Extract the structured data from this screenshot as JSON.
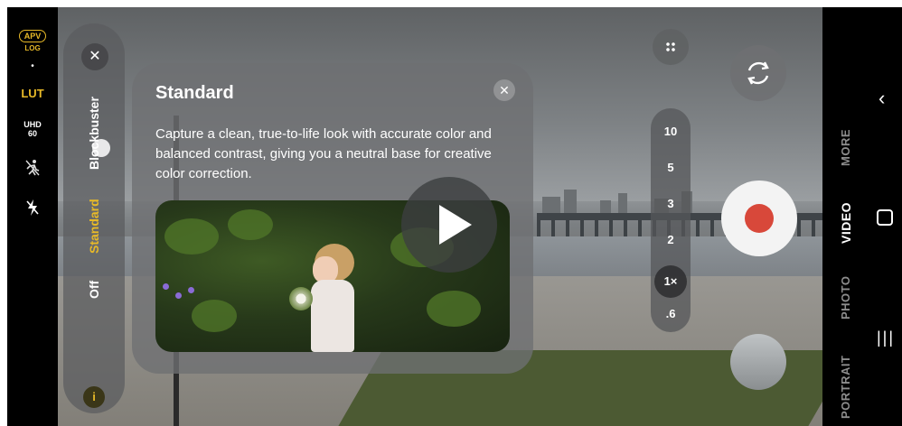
{
  "status_bar": {
    "apv_label": "APV",
    "log_label": "LOG",
    "dot": "•",
    "lut_label": "LUT",
    "resolution": "UHD",
    "fps": "60",
    "motion_icon": "running-person-icon",
    "flash_icon": "flash-off-icon",
    "accent_color": "#e7b928"
  },
  "filter_menu": {
    "close_icon": "close-icon",
    "options": [
      "Blockbuster",
      "Standard",
      "Off"
    ],
    "selected": "Standard",
    "info_label": "i"
  },
  "info_card": {
    "title": "Standard",
    "close_icon": "close-icon",
    "description": "Capture a clean, true-to-life look with accurate color and balanced contrast, giving you a neutral base for creative color correction.",
    "play_icon": "play-icon"
  },
  "zoom": {
    "levels": [
      "10",
      "5",
      "3",
      "2",
      "1×",
      ".6"
    ],
    "selected": "1×"
  },
  "controls": {
    "grid_icon": "grid-icon",
    "flip_icon": "flip-camera-icon",
    "shutter_icon": "record-icon",
    "record_color": "#d8483a",
    "gallery_icon": "gallery-thumbnail"
  },
  "modes": {
    "items": [
      "MORE",
      "VIDEO",
      "PHOTO",
      "PORTRAIT"
    ],
    "selected": "VIDEO"
  },
  "nav": {
    "back": "‹",
    "home": "home",
    "recent": "|||"
  }
}
